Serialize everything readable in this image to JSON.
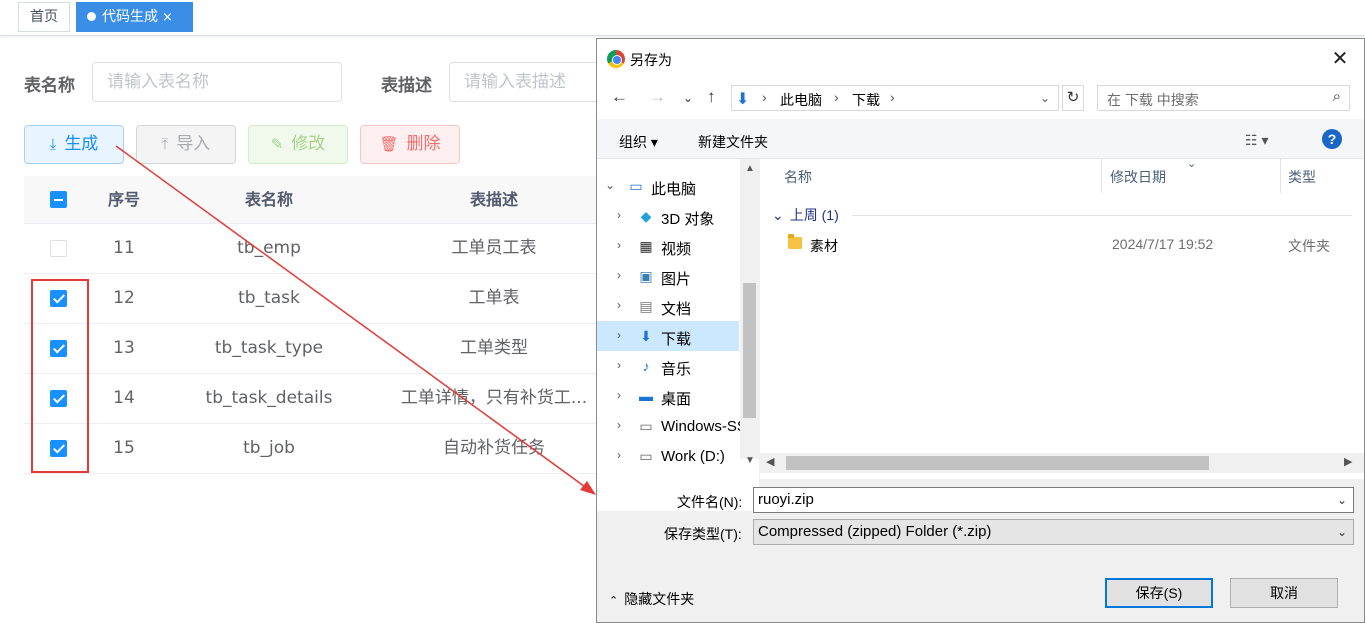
{
  "tabs": {
    "home": "首页",
    "active": "代码生成",
    "close": "×"
  },
  "search": {
    "table_name_label": "表名称",
    "table_name_placeholder": "请输入表名称",
    "table_desc_label": "表描述",
    "table_desc_placeholder": "请输入表描述"
  },
  "toolbar": {
    "generate": "生成",
    "import": "导入",
    "modify": "修改",
    "delete": "删除"
  },
  "table": {
    "columns": [
      "序号",
      "表名称",
      "表描述"
    ],
    "rows": [
      {
        "no": "11",
        "name": "tb_emp",
        "desc": "工单员工表",
        "checked": false
      },
      {
        "no": "12",
        "name": "tb_task",
        "desc": "工单表",
        "checked": true
      },
      {
        "no": "13",
        "name": "tb_task_type",
        "desc": "工单类型",
        "checked": true
      },
      {
        "no": "14",
        "name": "tb_task_details",
        "desc": "工单详情，只有补货工...",
        "checked": true
      },
      {
        "no": "15",
        "name": "tb_job",
        "desc": "自动补货任务",
        "checked": true
      }
    ]
  },
  "dialog": {
    "title": "另存为",
    "close": "✕",
    "address": [
      "此电脑",
      "下载"
    ],
    "search_placeholder": "在 下载 中搜索",
    "organize": "组织 ▾",
    "new_folder": "新建文件夹",
    "help": "?",
    "tree": [
      {
        "label": "此电脑",
        "icon": "pc-icon"
      },
      {
        "label": "3D 对象",
        "icon": "cube-icon"
      },
      {
        "label": "视频",
        "icon": "video-icon"
      },
      {
        "label": "图片",
        "icon": "picture-icon"
      },
      {
        "label": "文档",
        "icon": "document-icon"
      },
      {
        "label": "下载",
        "icon": "download-icon"
      },
      {
        "label": "音乐",
        "icon": "music-icon"
      },
      {
        "label": "桌面",
        "icon": "desktop-icon"
      },
      {
        "label": "Windows-SSD",
        "icon": "drive-icon"
      },
      {
        "label": "Work (D:)",
        "icon": "drive-icon"
      }
    ],
    "file_columns": [
      "名称",
      "修改日期",
      "类型"
    ],
    "group_label": "上周 (1)",
    "files": [
      {
        "name": "素材",
        "date": "2024/7/17 19:52",
        "type": "文件夹"
      }
    ],
    "filename_label": "文件名(N):",
    "filename_value": "ruoyi.zip",
    "filetype_label": "保存类型(T):",
    "filetype_value": "Compressed (zipped) Folder (*.zip)",
    "hide_folders": "隐藏文件夹",
    "save_button": "保存(S)",
    "cancel_button": "取消"
  },
  "colors": {
    "primary": "#1890ff",
    "annotation_red": "#e53935",
    "selection": "#cce8ff"
  }
}
